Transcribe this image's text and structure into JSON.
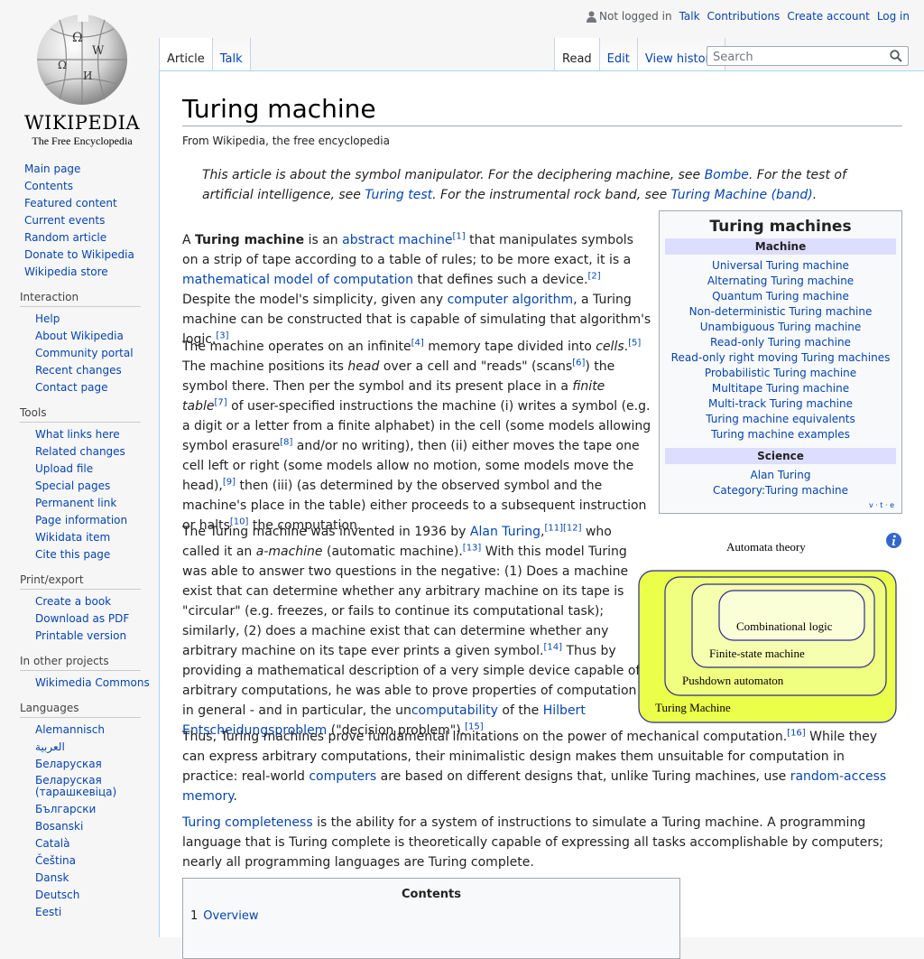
{
  "logo": {
    "wordmark": "Wikipedia",
    "tagline": "The Free Encyclopedia"
  },
  "personal": {
    "not_logged_in": "Not logged in",
    "talk": "Talk",
    "contributions": "Contributions",
    "create_account": "Create account",
    "login": "Log in"
  },
  "tabs": {
    "article": "Article",
    "talk": "Talk",
    "read": "Read",
    "edit": "Edit",
    "history": "View history"
  },
  "search": {
    "placeholder": "Search"
  },
  "sidebar": {
    "main": [
      "Main page",
      "Contents",
      "Featured content",
      "Current events",
      "Random article",
      "Donate to Wikipedia",
      "Wikipedia store"
    ],
    "interaction": {
      "heading": "Interaction",
      "items": [
        "Help",
        "About Wikipedia",
        "Community portal",
        "Recent changes",
        "Contact page"
      ]
    },
    "tools": {
      "heading": "Tools",
      "items": [
        "What links here",
        "Related changes",
        "Upload file",
        "Special pages",
        "Permanent link",
        "Page information",
        "Wikidata item",
        "Cite this page"
      ]
    },
    "print": {
      "heading": "Print/export",
      "items": [
        "Create a book",
        "Download as PDF",
        "Printable version"
      ]
    },
    "other": {
      "heading": "In other projects",
      "items": [
        "Wikimedia Commons"
      ]
    },
    "languages": {
      "heading": "Languages",
      "items": [
        "Alemannisch",
        "العربية",
        "Беларуская",
        "Беларуская (тарашкевіца)",
        "Български",
        "Bosanski",
        "Català",
        "Čeština",
        "Dansk",
        "Deutsch",
        "Eesti"
      ]
    }
  },
  "article": {
    "title": "Turing machine",
    "tagline": "From Wikipedia, the free encyclopedia",
    "hatnote": {
      "t1": "This article is about the symbol manipulator. For the deciphering machine, see ",
      "l1": "Bombe",
      "t2": ". For the test of artificial intelligence, see ",
      "l2": "Turing test",
      "t3": ". For the instrumental rock band, see ",
      "l3": "Turing Machine (band)",
      "t4": "."
    },
    "toc": {
      "title": "Contents",
      "items": [
        {
          "num": "1",
          "label": "Overview"
        }
      ]
    }
  },
  "navbox": {
    "title": "Turing machines",
    "groups": [
      {
        "heading": "Machine",
        "links": [
          "Universal Turing machine",
          "Alternating Turing machine",
          "Quantum Turing machine",
          "Non-deterministic Turing machine",
          "Unambiguous Turing machine",
          "Read-only Turing machine",
          "Read-only right moving Turing machines",
          "Probabilistic Turing machine",
          "Multitape Turing machine",
          "Multi-track Turing machine",
          "Turing machine equivalents",
          "Turing machine examples"
        ]
      },
      {
        "heading": "Science",
        "links": [
          "Alan Turing",
          "Category:Turing machine"
        ]
      }
    ],
    "vte": "v · t · e"
  },
  "diagram": {
    "title": "Automata theory",
    "layers": [
      "Turing Machine",
      "Pushdown automaton",
      "Finite-state machine",
      "Combinational logic"
    ],
    "colors": [
      "#ebff4a",
      "#f1ff80",
      "#f6ffaf",
      "#fbffd8"
    ],
    "border": "#2b2b8c"
  },
  "colors": {
    "link": "#0645ad",
    "group_bg": "#ddddff",
    "content_border": "#a7d7f9"
  }
}
